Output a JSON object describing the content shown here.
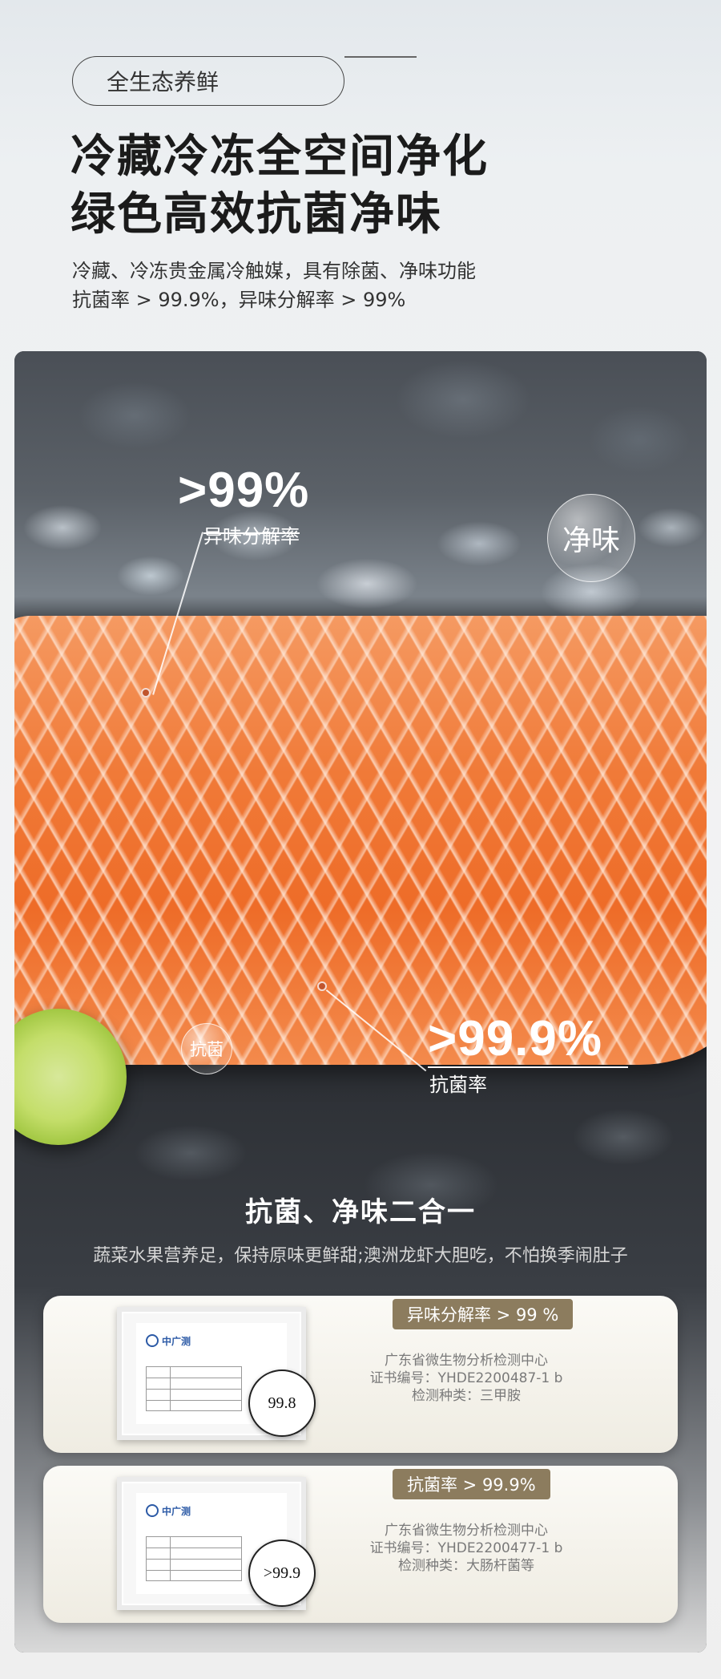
{
  "header": {
    "pill_label": "全生态养鲜",
    "title_line1": "冷藏冷冻全空间净化",
    "title_line2": "绿色高效抗菌净味",
    "desc_line1": "冷藏、冷冻贵金属冷触媒，具有除菌、净味功能",
    "desc_line2": "抗菌率 > 99.9%，异味分解率 > 99%"
  },
  "photo": {
    "stat1_value": ">99%",
    "stat1_label": "异味分解率",
    "stat2_value": ">99.9%",
    "stat2_label": "抗菌率",
    "bubble_big": "净味",
    "bubble_small": "抗菌",
    "subtitle": "抗菌、净味二合一",
    "subdesc": "蔬菜水果营养足，保持原味更鲜甜;澳洲龙虾大胆吃，不怕换季闹肚子"
  },
  "certs": [
    {
      "tag": "异味分解率 > 99 %",
      "lines": [
        "广东省微生物分析检测中心",
        "证书编号：YHDE2200487-1 b",
        "检测种类：三甲胺"
      ],
      "magnified_value": "99.8",
      "logo_text": "中广测"
    },
    {
      "tag": "抗菌率 > 99.9%",
      "lines": [
        "广东省微生物分析检测中心",
        "证书编号：YHDE2200477-1 b",
        "检测种类：大肠杆菌等"
      ],
      "magnified_value": ">99.9",
      "logo_text": "中广测"
    }
  ],
  "colors": {
    "salmon": "#f07a38",
    "tag_bg": "#8c7c5e",
    "marker_dot": "#c0552d"
  }
}
